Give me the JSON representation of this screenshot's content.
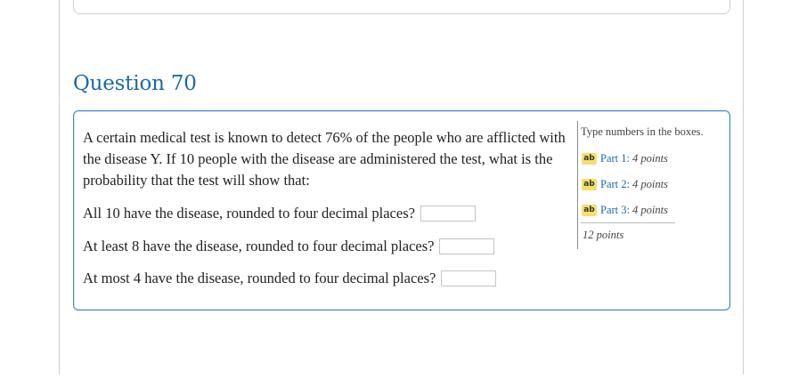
{
  "question": {
    "title": "Question 70",
    "text": "A certain medical test is known to detect 76% of the people who are afflicted with the disease Y. If 10 people with the disease are administered the test, what is the probability that the test will show that:",
    "parts": [
      {
        "label": "All 10 have the disease, rounded to four decimal places?",
        "value": ""
      },
      {
        "label": "At least 8 have the disease, rounded to four decimal places?",
        "value": ""
      },
      {
        "label": "At most 4 have the disease, rounded to four decimal places?",
        "value": ""
      }
    ]
  },
  "sidebar": {
    "hint": "Type numbers in the boxes.",
    "icon_text": "ab",
    "parts": [
      {
        "label": "Part 1:",
        "points": "4 points",
        "icon": "edit-text-icon"
      },
      {
        "label": "Part 2:",
        "points": "4 points",
        "icon": "edit-text-icon"
      },
      {
        "label": "Part 3:",
        "points": "4 points",
        "icon": "edit-text-icon"
      }
    ],
    "total": "12 points"
  },
  "colors": {
    "accent": "#1a6aa6",
    "card_border": "#3d86c6",
    "icon_bg": "#f4e06a"
  }
}
